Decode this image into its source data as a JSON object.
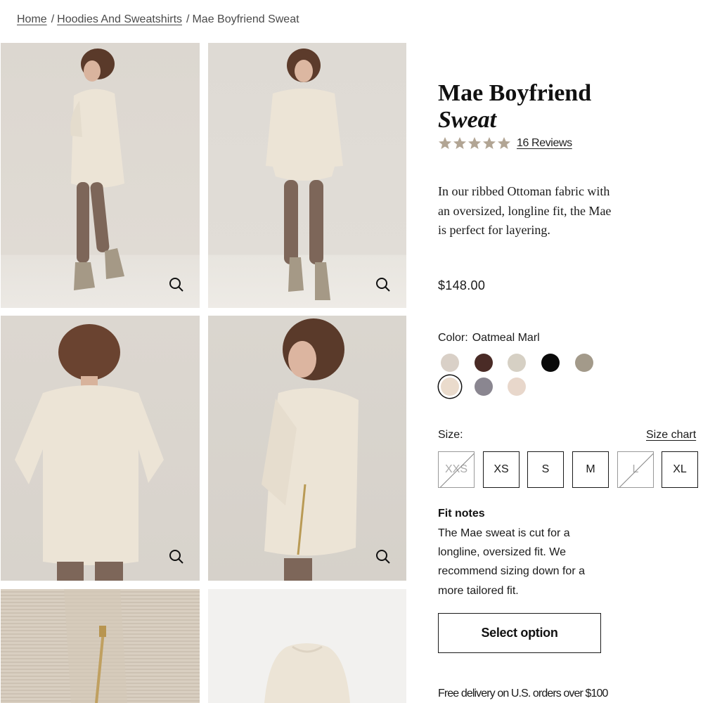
{
  "breadcrumb": {
    "items": [
      {
        "label": "Home",
        "link": true
      },
      {
        "label": "Hoodies And Sweatshirts",
        "link": true
      },
      {
        "label": "Mae Boyfriend Sweat",
        "link": false
      }
    ],
    "separator": "/"
  },
  "product": {
    "title_line1": "Mae Boyfriend",
    "title_line2": "Sweat",
    "rating": 5,
    "reviews_label": "16 Reviews",
    "description": "In our ribbed Ottoman fabric with an oversized, longline fit, the Mae is perfect for layering.",
    "price": "$148.00"
  },
  "color": {
    "label": "Color:",
    "selected_name": "Oatmeal Marl",
    "swatches": [
      "#d9d0c7",
      "#4a2b26",
      "#d6d0c4",
      "#0a0a0a",
      "#a39a8a",
      "#eadbcc",
      "#8a8690",
      "#e8d7cb"
    ],
    "selected_index": 5
  },
  "size": {
    "label": "Size:",
    "chart_label": "Size chart",
    "options": [
      {
        "label": "XXS",
        "available": false
      },
      {
        "label": "XS",
        "available": true
      },
      {
        "label": "S",
        "available": true
      },
      {
        "label": "M",
        "available": true
      },
      {
        "label": "L",
        "available": false
      },
      {
        "label": "XL",
        "available": true
      }
    ]
  },
  "fit": {
    "title": "Fit notes",
    "text": "The Mae sweat is cut for a longline, oversized fit. We recommend sizing down for a more tailored fit."
  },
  "cta": {
    "label": "Select option"
  },
  "delivery": {
    "text": "Free delivery on U.S. orders over $100"
  },
  "colors": {
    "accent_star": "#b2a594",
    "text": "#1a1a1a",
    "sweater": "#ece4d6",
    "leggings": "#7d6659"
  },
  "icons": {
    "zoom": "magnifier-icon",
    "star": "star-icon"
  }
}
